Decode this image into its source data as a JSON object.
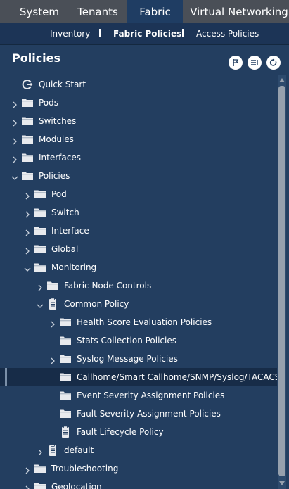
{
  "top_nav": {
    "tabs": [
      {
        "label": "System",
        "active": false
      },
      {
        "label": "Tenants",
        "active": false
      },
      {
        "label": "Fabric",
        "active": true
      },
      {
        "label": "Virtual Networking",
        "active": false
      }
    ]
  },
  "sub_nav": {
    "items": [
      {
        "label": "Inventory",
        "active": false
      },
      {
        "label": "Fabric Policies",
        "active": true
      },
      {
        "label": "Access Policies",
        "active": false
      }
    ]
  },
  "panel": {
    "title": "Policies",
    "toolbar": [
      {
        "icon": "flag-icon"
      },
      {
        "icon": "collapse-list-icon"
      },
      {
        "icon": "refresh-icon"
      }
    ]
  },
  "tree": {
    "selected_label": "Callhome/Smart Callhome/SNMP/Syslog/TACACS",
    "items": [
      {
        "label": "Quick Start",
        "level": 0,
        "chevron": "none",
        "icon": "quick-start-icon"
      },
      {
        "label": "Pods",
        "level": 0,
        "chevron": "right",
        "icon": "folder-icon"
      },
      {
        "label": "Switches",
        "level": 0,
        "chevron": "right",
        "icon": "folder-icon"
      },
      {
        "label": "Modules",
        "level": 0,
        "chevron": "right",
        "icon": "folder-icon"
      },
      {
        "label": "Interfaces",
        "level": 0,
        "chevron": "right",
        "icon": "folder-icon"
      },
      {
        "label": "Policies",
        "level": 0,
        "chevron": "down",
        "icon": "folder-icon"
      },
      {
        "label": "Pod",
        "level": 1,
        "chevron": "right",
        "icon": "folder-icon"
      },
      {
        "label": "Switch",
        "level": 1,
        "chevron": "right",
        "icon": "folder-icon"
      },
      {
        "label": "Interface",
        "level": 1,
        "chevron": "right",
        "icon": "folder-icon"
      },
      {
        "label": "Global",
        "level": 1,
        "chevron": "right",
        "icon": "folder-icon"
      },
      {
        "label": "Monitoring",
        "level": 1,
        "chevron": "down",
        "icon": "folder-icon"
      },
      {
        "label": "Fabric Node Controls",
        "level": 2,
        "chevron": "right",
        "icon": "folder-icon"
      },
      {
        "label": "Common Policy",
        "level": 2,
        "chevron": "down",
        "icon": "policy-document-icon"
      },
      {
        "label": "Health Score Evaluation Policies",
        "level": 3,
        "chevron": "right",
        "icon": "folder-icon"
      },
      {
        "label": "Stats Collection Policies",
        "level": 3,
        "chevron": "none",
        "icon": "folder-icon"
      },
      {
        "label": "Syslog Message Policies",
        "level": 3,
        "chevron": "right",
        "icon": "folder-icon"
      },
      {
        "label": "Callhome/Smart Callhome/SNMP/Syslog/TACACS",
        "level": 3,
        "chevron": "none",
        "icon": "folder-icon"
      },
      {
        "label": "Event Severity Assignment Policies",
        "level": 3,
        "chevron": "none",
        "icon": "folder-icon"
      },
      {
        "label": "Fault Severity Assignment Policies",
        "level": 3,
        "chevron": "none",
        "icon": "folder-icon"
      },
      {
        "label": "Fault Lifecycle Policy",
        "level": 3,
        "chevron": "none",
        "icon": "policy-document-icon"
      },
      {
        "label": "default",
        "level": 2,
        "chevron": "right",
        "icon": "policy-document-icon"
      },
      {
        "label": "Troubleshooting",
        "level": 1,
        "chevron": "right",
        "icon": "folder-icon"
      },
      {
        "label": "Geolocation",
        "level": 1,
        "chevron": "right",
        "icon": "folder-icon"
      }
    ]
  },
  "colors": {
    "background": "#233e60",
    "top_nav": "#4a4f57",
    "active_tab": "#1f3d63",
    "selected_row": "#172c48",
    "icon": "#e8eaee"
  }
}
